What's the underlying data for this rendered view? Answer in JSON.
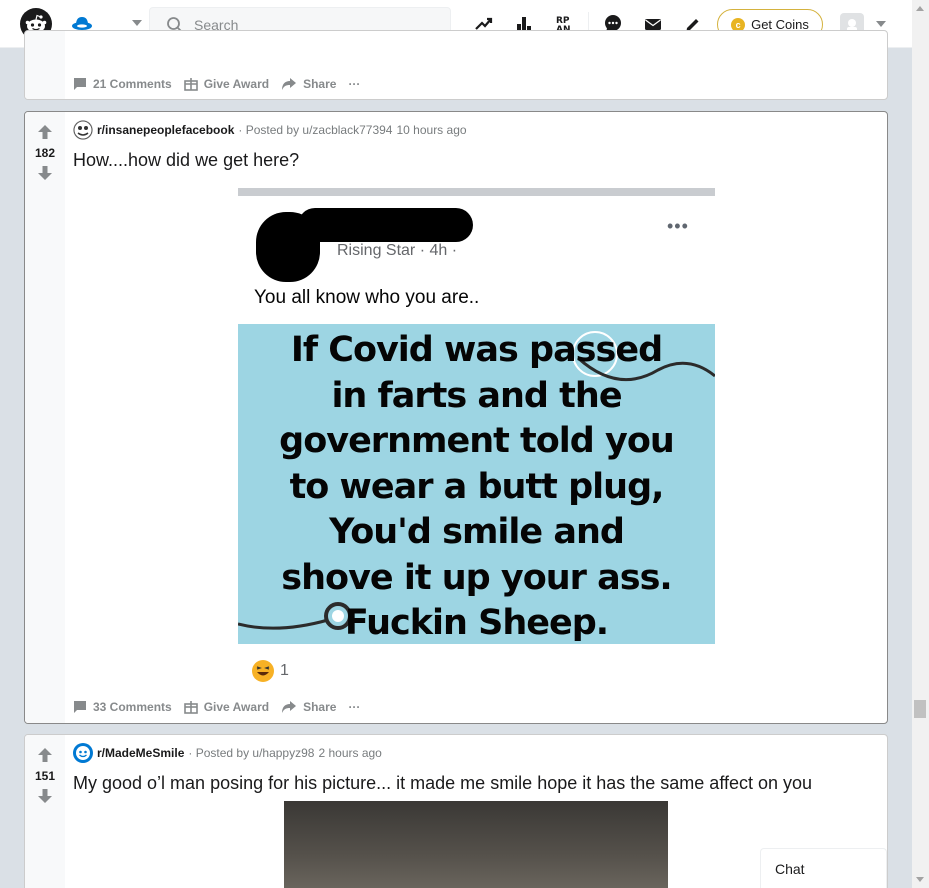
{
  "topbar": {
    "search_placeholder": "Search",
    "get_coins_label": "Get Coins",
    "coin_symbol": "c"
  },
  "posts": [
    {
      "comments_label": "21 Comments",
      "award_label": "Give Award",
      "share_label": "Share",
      "more_label": "···"
    },
    {
      "score": "182",
      "subreddit": "r/insanepeoplefacebook",
      "posted_by": "· Posted by u/zacblack77394",
      "time": "10 hours ago",
      "title": "How....how did we get here?",
      "image": {
        "fb_meta": "Rising Star · 4h · ",
        "fb_dots": "•••",
        "fb_text": "You all know who you are..",
        "meme_lines": [
          "If Covid was passed",
          "in farts and the",
          "government told you",
          "to wear a butt plug,",
          "You'd smile and",
          "shove it up your ass.",
          "Fuckin Sheep."
        ],
        "reaction_count": "1"
      },
      "comments_label": "33 Comments",
      "award_label": "Give Award",
      "share_label": "Share",
      "more_label": "···"
    },
    {
      "score": "151",
      "subreddit": "r/MadeMeSmile",
      "posted_by": "· Posted by u/happyz98",
      "time": "2 hours ago",
      "title": "My good o’l man posing for his picture... it made me smile hope it has the same affect on you"
    }
  ],
  "chat": {
    "label": "Chat"
  },
  "colors": {
    "accent": "#0079d3",
    "coins_border": "#d4b23e",
    "meme_bg": "#9dd5e3"
  }
}
